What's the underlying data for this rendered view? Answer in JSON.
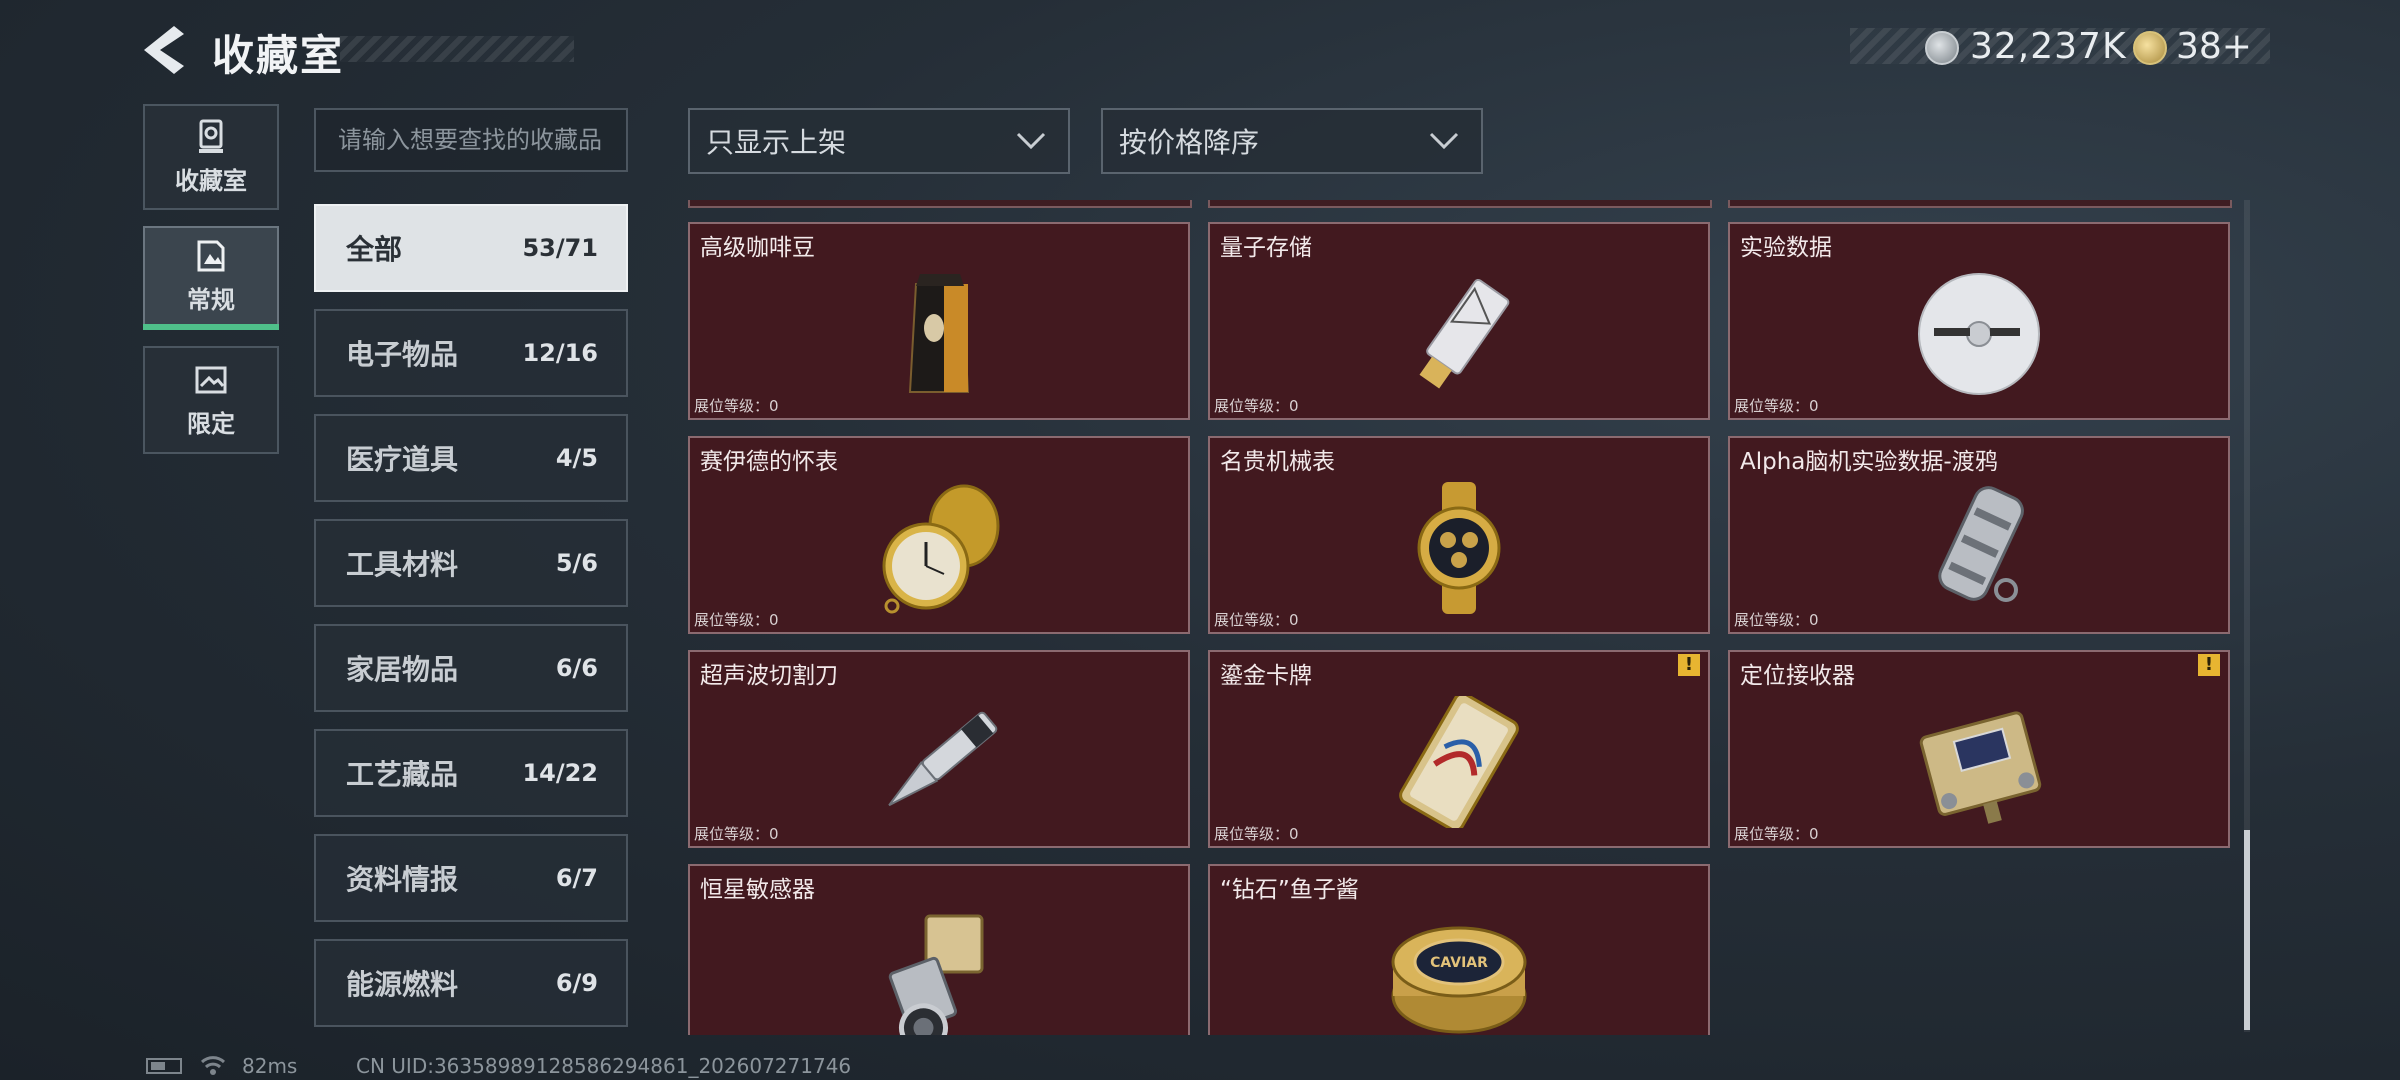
{
  "header": {
    "title": "收藏室",
    "coin_value": "32,237K",
    "gem_value": "38+"
  },
  "nav": {
    "tabs": [
      {
        "label": "收藏室",
        "icon": "trophy-icon",
        "active": false
      },
      {
        "label": "常规",
        "icon": "document-icon",
        "active": true
      },
      {
        "label": "限定",
        "icon": "frame-icon",
        "active": false
      }
    ]
  },
  "search": {
    "placeholder": "请输入想要查找的收藏品"
  },
  "categories": [
    {
      "name": "全部",
      "count": "53/71",
      "active": true
    },
    {
      "name": "电子物品",
      "count": "12/16"
    },
    {
      "name": "医疗道具",
      "count": "4/5"
    },
    {
      "name": "工具材料",
      "count": "5/6"
    },
    {
      "name": "家居物品",
      "count": "6/6"
    },
    {
      "name": "工艺藏品",
      "count": "14/22"
    },
    {
      "name": "资料情报",
      "count": "6/7"
    },
    {
      "name": "能源燃料",
      "count": "6/9"
    }
  ],
  "filters": {
    "display_filter": "只显示上架",
    "sort_order": "按价格降序"
  },
  "items": [
    {
      "name": "高级咖啡豆",
      "level": "展位等级：0",
      "icon": "coffee-bag-icon",
      "warning": false
    },
    {
      "name": "量子存储",
      "level": "展位等级：0",
      "icon": "usb-drive-icon",
      "warning": false
    },
    {
      "name": "实验数据",
      "level": "展位等级：0",
      "icon": "disc-icon",
      "warning": false
    },
    {
      "name": "赛伊德的怀表",
      "level": "展位等级：0",
      "icon": "pocket-watch-icon",
      "warning": false
    },
    {
      "name": "名贵机械表",
      "level": "展位等级：0",
      "icon": "wristwatch-icon",
      "warning": false
    },
    {
      "name": "Alpha脑机实验数据-渡鸦",
      "level": "展位等级：0",
      "icon": "data-canister-icon",
      "warning": false
    },
    {
      "name": "超声波切割刀",
      "level": "展位等级：0",
      "icon": "cutter-knife-icon",
      "warning": false
    },
    {
      "name": "鎏金卡牌",
      "level": "展位等级：0",
      "icon": "gold-card-icon",
      "warning": true
    },
    {
      "name": "定位接收器",
      "level": "展位等级：0",
      "icon": "receiver-device-icon",
      "warning": true
    },
    {
      "name": "恒星敏感器",
      "level": "",
      "icon": "star-sensor-icon",
      "warning": false
    },
    {
      "name": "“钻石”鱼子酱",
      "level": "",
      "icon": "caviar-tin-icon",
      "warning": false,
      "art_text": "CAVIAR"
    }
  ],
  "footer": {
    "ping": "82ms",
    "uid": "CN UID:36358989128586294861_202607271746"
  },
  "colors": {
    "card_bg": "#42191f",
    "card_border": "#8b6a70",
    "active_tab_accent": "#4fc08a",
    "warning": "#e7b531"
  }
}
